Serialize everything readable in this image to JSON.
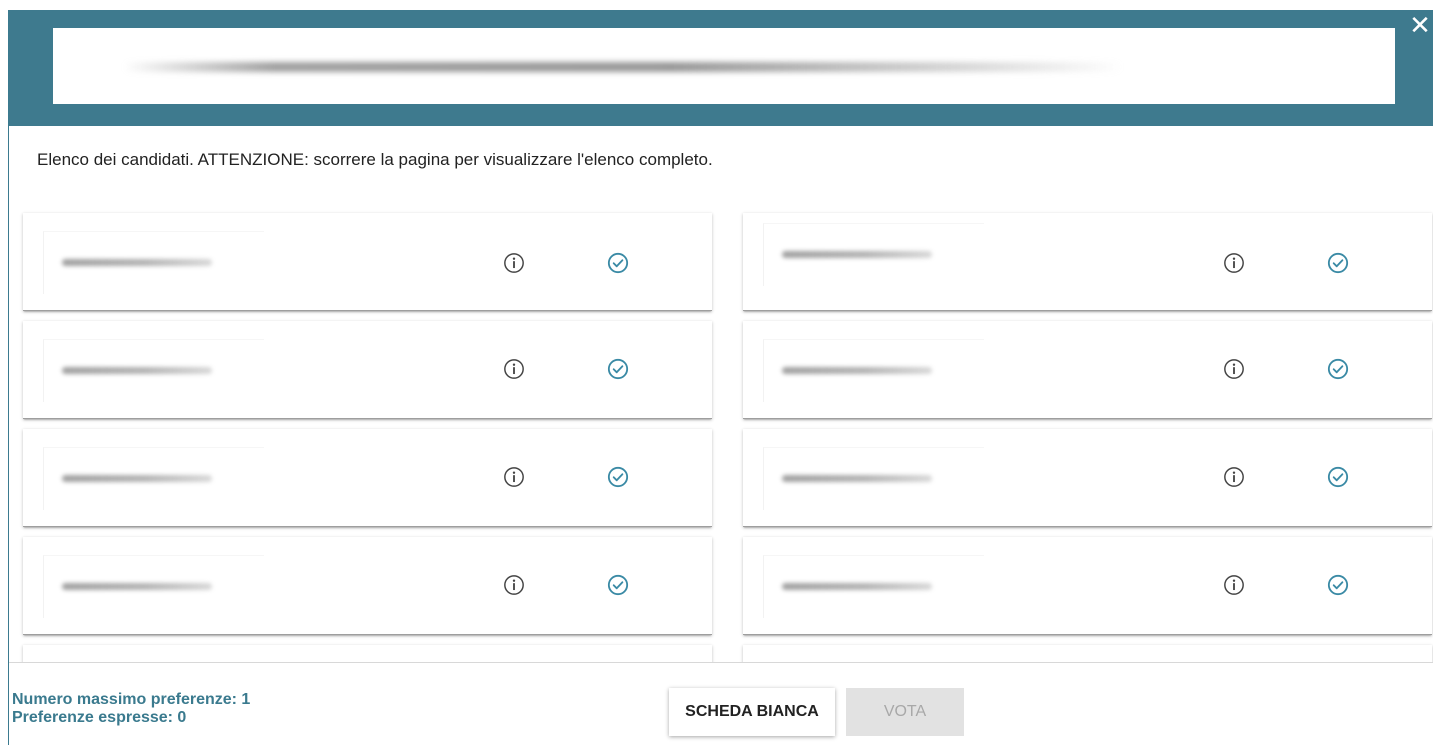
{
  "header": {
    "close_symbol": "✕",
    "accent_color": "#3e7a8e"
  },
  "instructions": "Elenco dei candidati. ATTENZIONE: scorrere la pagina per visualizzare l'elenco completo.",
  "candidates": {
    "name_redacted": true,
    "icons": [
      "info-icon",
      "check-circle-icon"
    ],
    "check_color": "#3a8aa5"
  },
  "footer": {
    "max_preferences": "Numero massimo preferenze: 1",
    "expressed_preferences": "Preferenze espresse: 0",
    "blank_ballot_label": "SCHEDA BIANCA",
    "vote_label": "VOTA"
  }
}
